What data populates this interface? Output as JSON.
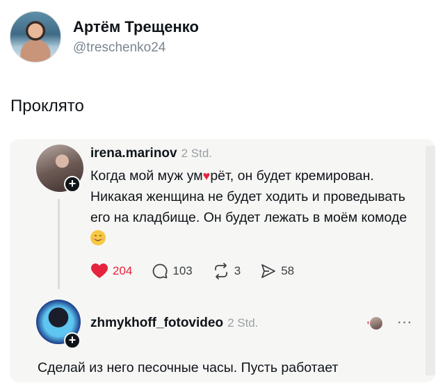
{
  "author": {
    "name": "Артём Трещенко",
    "handle": "@treschenko24"
  },
  "tweet": {
    "text": "Проклято"
  },
  "embed": {
    "comment1": {
      "username": "irena.marinov",
      "time": "2 Std.",
      "text_part1": "Когда мой муж ум",
      "text_part2": "рёт, он будет кремирован. Никакая женщина не будет ходить и проведывать его на кладбище. Он будет лежать в моём комоде ",
      "actions": {
        "likes": "204",
        "comments": "103",
        "reposts": "3",
        "shares": "58"
      }
    },
    "comment2": {
      "username": "zhmykhoff_fotovideo",
      "time": "2 Std.",
      "text": "Сделай из него песочные часы. Пусть работает"
    },
    "icons": {
      "heart": "heart-icon",
      "comment": "comment-icon",
      "repost": "repost-icon",
      "share": "share-icon",
      "more": "more-icon",
      "plus": "plus-icon"
    },
    "colors": {
      "like": "#e5243f",
      "card_bg": "#f6f6f4"
    }
  }
}
